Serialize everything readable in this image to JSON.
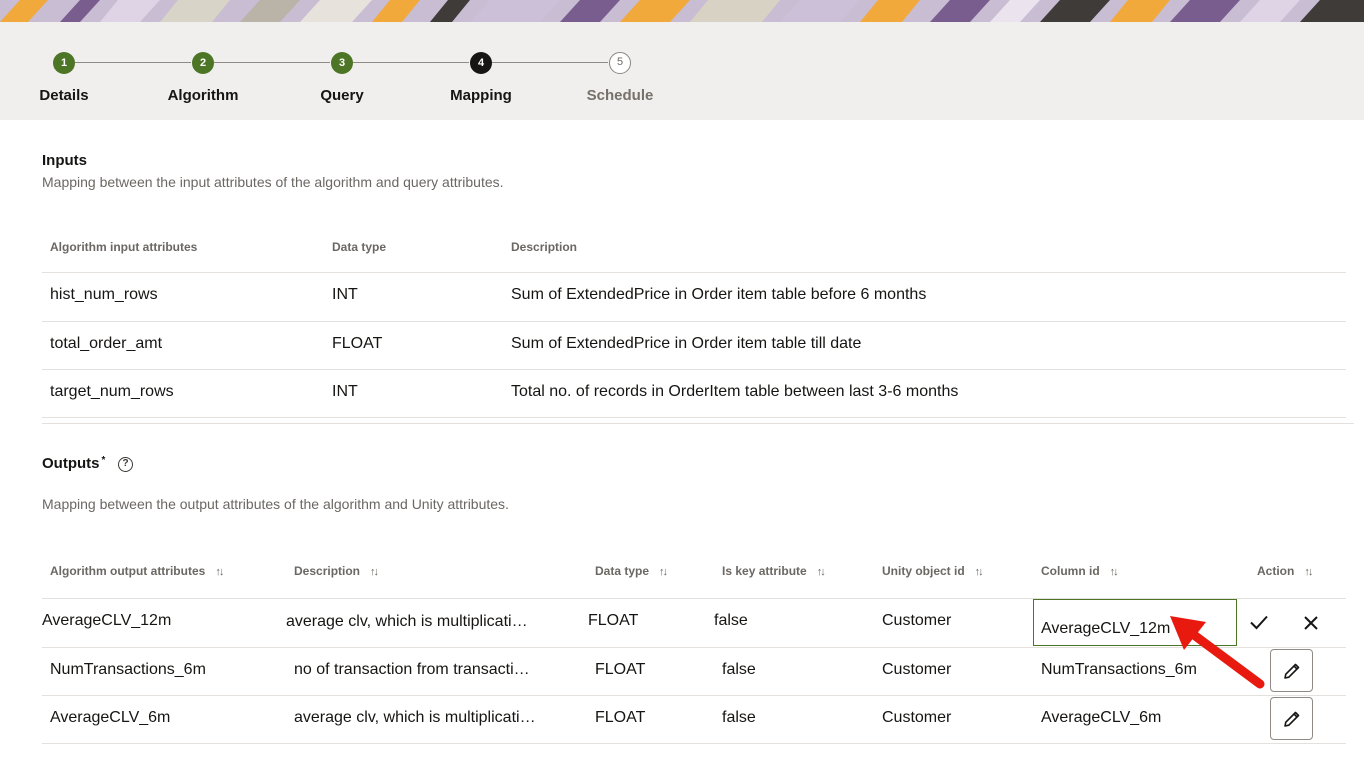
{
  "stepper": {
    "steps": [
      {
        "number": "1",
        "label": "Details"
      },
      {
        "number": "2",
        "label": "Algorithm"
      },
      {
        "number": "3",
        "label": "Query"
      },
      {
        "number": "4",
        "label": "Mapping"
      },
      {
        "number": "5",
        "label": "Schedule"
      }
    ],
    "current_step": 4
  },
  "inputs": {
    "title": "Inputs",
    "description": "Mapping between the input attributes of the algorithm and query attributes.",
    "columns": [
      "Algorithm input attributes",
      "Data type",
      "Description"
    ],
    "rows": [
      {
        "attribute": "hist_num_rows",
        "data_type": "INT",
        "description": "Sum of ExtendedPrice in Order item table before 6 months"
      },
      {
        "attribute": "total_order_amt",
        "data_type": "FLOAT",
        "description": "Sum of ExtendedPrice in Order item table till date"
      },
      {
        "attribute": "target_num_rows",
        "data_type": "INT",
        "description": "Total no. of records in OrderItem table between last 3-6 months"
      }
    ]
  },
  "outputs": {
    "title": "Outputs",
    "required_marker": "*",
    "help_icon": "help-icon",
    "description": "Mapping between the output attributes of the algorithm and Unity attributes.",
    "columns": [
      "Algorithm output attributes",
      "Description",
      "Data type",
      "Is key attribute",
      "Unity object id",
      "Column id",
      "Action"
    ],
    "rows": [
      {
        "attribute": "AverageCLV_12m",
        "description": "average clv, which is multiplicati…",
        "data_type": "FLOAT",
        "is_key": "false",
        "unity_object": "Customer",
        "column_id": "AverageCLV_12m",
        "editing": true
      },
      {
        "attribute": "NumTransactions_6m",
        "description": "no of transaction from transacti…",
        "data_type": "FLOAT",
        "is_key": "false",
        "unity_object": "Customer",
        "column_id": "NumTransactions_6m",
        "editing": false
      },
      {
        "attribute": "AverageCLV_6m",
        "description": "average clv, which is multiplicati…",
        "data_type": "FLOAT",
        "is_key": "false",
        "unity_object": "Customer",
        "column_id": "AverageCLV_6m",
        "editing": false
      }
    ]
  },
  "icons": {
    "confirm": "checkmark-icon",
    "cancel": "close-icon",
    "edit": "pencil-icon",
    "sort": "sort-icon"
  },
  "colors": {
    "step_done": "#4c7526",
    "step_current": "#161513",
    "annotation_arrow": "#e8190f"
  }
}
